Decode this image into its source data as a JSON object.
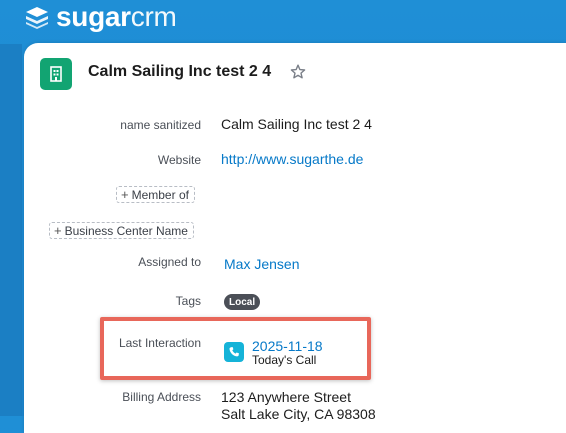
{
  "brand": {
    "name_bold": "sugar",
    "name_light": "crm"
  },
  "record": {
    "title": "Calm Sailing Inc test 2 4",
    "icon": "building-icon",
    "favorite_icon": "star-icon"
  },
  "fields": {
    "name_sanitized_label": "name sanitized",
    "name_sanitized_value": "Calm Sailing Inc test 2 4",
    "website_label": "Website",
    "website_value": "http://www.sugarthe.de",
    "member_of_label": "Member of",
    "business_center_label": "Business Center Name",
    "assigned_to_label": "Assigned to",
    "assigned_to_value": "Max Jensen",
    "tags_label": "Tags",
    "tag_value": "Local",
    "last_interaction_label": "Last Interaction",
    "last_interaction_date": "2025-11-18",
    "last_interaction_desc": "Today's Call",
    "billing_address_label": "Billing Address",
    "billing_address_line1": "123 Anywhere Street",
    "billing_address_line2": "Salt Lake City, CA 98308"
  },
  "colors": {
    "header_bg": "#1f8fd6",
    "record_icon_bg": "#12a472",
    "link": "#0679c8",
    "highlight": "#e8675a",
    "call_icon_bg": "#15b3d8",
    "tag_bg": "#4b4f57"
  }
}
